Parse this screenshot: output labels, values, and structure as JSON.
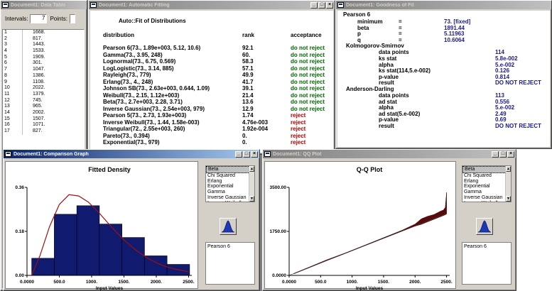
{
  "data_table": {
    "title": "Document1: Data Table",
    "intervals_label": "Intervals:",
    "intervals_value": "7",
    "points_label": "Points:",
    "rows": [
      {
        "idx": "1",
        "val": "1668."
      },
      {
        "idx": "2",
        "val": "817."
      },
      {
        "idx": "3",
        "val": "1443."
      },
      {
        "idx": "4",
        "val": "1533."
      },
      {
        "idx": "5",
        "val": "1909."
      },
      {
        "idx": "6",
        "val": "301."
      },
      {
        "idx": "7",
        "val": "1047."
      },
      {
        "idx": "8",
        "val": "1386."
      },
      {
        "idx": "9",
        "val": "1108."
      },
      {
        "idx": "10",
        "val": "2022."
      },
      {
        "idx": "11",
        "val": "1379."
      },
      {
        "idx": "12",
        "val": "745."
      },
      {
        "idx": "13",
        "val": "965."
      },
      {
        "idx": "14",
        "val": "2002."
      },
      {
        "idx": "15",
        "val": "1507."
      },
      {
        "idx": "16",
        "val": "1071."
      },
      {
        "idx": "17",
        "val": "827."
      }
    ]
  },
  "auto_fit": {
    "title": "Document1: Automatic Fitting",
    "header": "Auto::Fit of Distributions",
    "col_distribution": "distribution",
    "col_rank": "rank",
    "col_acceptance": "acceptance",
    "rows": [
      {
        "dist": "Pearson 6(73., 1.89e+003, 5.12, 10.6)",
        "rank": "92.1",
        "acc": "do not reject",
        "ok": true
      },
      {
        "dist": "Gamma(73., 3.95, 248)",
        "rank": "60.",
        "acc": "do not reject",
        "ok": true
      },
      {
        "dist": "Lognormal(73., 6.75, 0.569)",
        "rank": "58.3",
        "acc": "do not reject",
        "ok": true
      },
      {
        "dist": "LogLogistic(73., 3.14, 885)",
        "rank": "57.1",
        "acc": "do not reject",
        "ok": true
      },
      {
        "dist": "Rayleigh(73., 779)",
        "rank": "49.9",
        "acc": "do not reject",
        "ok": true
      },
      {
        "dist": "Erlang(73., 4., 248)",
        "rank": "41.7",
        "acc": "do not reject",
        "ok": true
      },
      {
        "dist": "Johnson SB(73., 2.63e+003, 0.644, 1.09)",
        "rank": "39.1",
        "acc": "do not reject",
        "ok": true
      },
      {
        "dist": "Weibull(73., 2.15, 1.12e+003)",
        "rank": "21.4",
        "acc": "do not reject",
        "ok": true
      },
      {
        "dist": "Beta(73., 2.7e+003, 2.28, 3.71)",
        "rank": "13.6",
        "acc": "do not reject",
        "ok": true
      },
      {
        "dist": "Inverse Gaussian(73., 2.54e+003, 979)",
        "rank": "12.9",
        "acc": "do not reject",
        "ok": true
      },
      {
        "dist": "Pearson 5(73., 2.73, 1.93e+003)",
        "rank": "1.74",
        "acc": "reject",
        "ok": false
      },
      {
        "dist": "Inverse Weibull(73., 1.44, 1.58e-003)",
        "rank": "4.76e-003",
        "acc": "reject",
        "ok": false
      },
      {
        "dist": "Triangular(72., 2.55e+003, 260)",
        "rank": "1.92e-004",
        "acc": "reject",
        "ok": false
      },
      {
        "dist": "Pareto(73., 0.394)",
        "rank": "0.",
        "acc": "reject",
        "ok": false
      },
      {
        "dist": "Exponential(73., 979)",
        "rank": "0.",
        "acc": "reject",
        "ok": false
      }
    ]
  },
  "gof": {
    "title": "Document1: Goodness of Fit",
    "dist_name": "Pearson 6",
    "params": [
      {
        "name": "minimum",
        "eq": "=",
        "val": "73. [fixed]"
      },
      {
        "name": "beta",
        "eq": "=",
        "val": "1891.44"
      },
      {
        "name": "p",
        "eq": "=",
        "val": "5.11963"
      },
      {
        "name": "q",
        "eq": "=",
        "val": "10.6064"
      }
    ],
    "ks_title": "Kolmogorov-Smirnov",
    "ks_rows": [
      {
        "name": "data points",
        "val": "114"
      },
      {
        "name": "ks stat",
        "val": "5.8e-002"
      },
      {
        "name": "alpha",
        "val": "5.e-002"
      },
      {
        "name": "ks stat(114,5.e-002)",
        "val": "0.126"
      },
      {
        "name": "p-value",
        "val": "0.814"
      },
      {
        "name": "result",
        "val": "DO NOT REJECT"
      }
    ],
    "ad_title": "Anderson-Darling",
    "ad_rows": [
      {
        "name": "data points",
        "val": "113"
      },
      {
        "name": "ad stat",
        "val": "0.556"
      },
      {
        "name": "alpha",
        "val": "5.e-002"
      },
      {
        "name": "ad stat(5.e-002)",
        "val": "2.49"
      },
      {
        "name": "p-value",
        "val": "0.69"
      },
      {
        "name": "result",
        "val": "DO NOT REJECT"
      }
    ]
  },
  "comparison": {
    "title": "Document1: Comparison Graph",
    "list_items": [
      "Beta",
      "Chi Squared",
      "Erlang",
      "Exponential",
      "Gamma",
      "Inverse Gaussian",
      "Inverse Weibull",
      "Johnson SB"
    ],
    "selected": "Pearson 6"
  },
  "qq": {
    "title": "Document1: QQ Plot",
    "list_items": [
      "Beta",
      "Chi Squared",
      "Erlang",
      "Exponential",
      "Gamma",
      "Inverse Gaussian",
      "Inverse Weibull",
      "Johnson SB"
    ],
    "selected": "Pearson 6"
  },
  "chart_data": [
    {
      "type": "bar",
      "title": "Fitted Density",
      "xlabel": "Input Values",
      "ylabel": "",
      "x_ticks": [
        "0.0000",
        "500.0",
        "1000.",
        "1500.",
        "2000.",
        "2500."
      ],
      "y_ticks": [
        "0.00",
        "0.18",
        "0.36"
      ],
      "xlim": [
        0,
        2550
      ],
      "ylim": [
        0,
        0.36
      ],
      "bins": [
        {
          "x0": 73,
          "x1": 422,
          "value": 0.07
        },
        {
          "x0": 422,
          "x1": 771,
          "value": 0.25
        },
        {
          "x0": 771,
          "x1": 1120,
          "value": 0.285
        },
        {
          "x0": 1120,
          "x1": 1469,
          "value": 0.21
        },
        {
          "x0": 1469,
          "x1": 1818,
          "value": 0.155
        },
        {
          "x0": 1818,
          "x1": 2167,
          "value": 0.08
        },
        {
          "x0": 2167,
          "x1": 2516,
          "value": 0.045
        }
      ],
      "curve": [
        [
          73,
          0.0
        ],
        [
          200,
          0.08
        ],
        [
          350,
          0.2
        ],
        [
          500,
          0.29
        ],
        [
          650,
          0.33
        ],
        [
          800,
          0.325
        ],
        [
          950,
          0.3
        ],
        [
          1100,
          0.26
        ],
        [
          1300,
          0.2
        ],
        [
          1500,
          0.145
        ],
        [
          1700,
          0.1
        ],
        [
          1900,
          0.065
        ],
        [
          2100,
          0.04
        ],
        [
          2300,
          0.025
        ],
        [
          2500,
          0.015
        ]
      ],
      "bar_color": "#101a6e",
      "curve_color": "#a01010"
    },
    {
      "type": "area",
      "title": "Q-Q Plot",
      "xlabel": "Input Values",
      "x_ticks": [
        "0.0000",
        "500.0",
        "1000.",
        "1500.",
        "2000.",
        "2500."
      ],
      "y_ticks": [
        "0.0000",
        "1750.00",
        "3500.00"
      ],
      "xlim": [
        0,
        2550
      ],
      "ylim": [
        0,
        3500
      ],
      "reference": [
        [
          0,
          0
        ],
        [
          2500,
          2450
        ]
      ],
      "upper": [
        [
          73,
          80
        ],
        [
          300,
          310
        ],
        [
          600,
          620
        ],
        [
          900,
          900
        ],
        [
          1200,
          1200
        ],
        [
          1500,
          1500
        ],
        [
          1800,
          1800
        ],
        [
          2000,
          2040
        ],
        [
          2100,
          2250
        ],
        [
          2200,
          2350
        ],
        [
          2300,
          2420
        ],
        [
          2400,
          2550
        ],
        [
          2450,
          2600
        ],
        [
          2480,
          2700
        ],
        [
          2500,
          3300
        ]
      ],
      "lower": [
        [
          73,
          60
        ],
        [
          300,
          285
        ],
        [
          600,
          590
        ],
        [
          900,
          880
        ],
        [
          1200,
          1180
        ],
        [
          1500,
          1480
        ],
        [
          1800,
          1770
        ],
        [
          2000,
          1960
        ],
        [
          2100,
          2030
        ],
        [
          2200,
          2130
        ],
        [
          2300,
          2230
        ],
        [
          2400,
          2330
        ],
        [
          2450,
          2380
        ],
        [
          2480,
          2410
        ],
        [
          2500,
          2440
        ]
      ],
      "fill_color": "#5a0a0a"
    }
  ]
}
